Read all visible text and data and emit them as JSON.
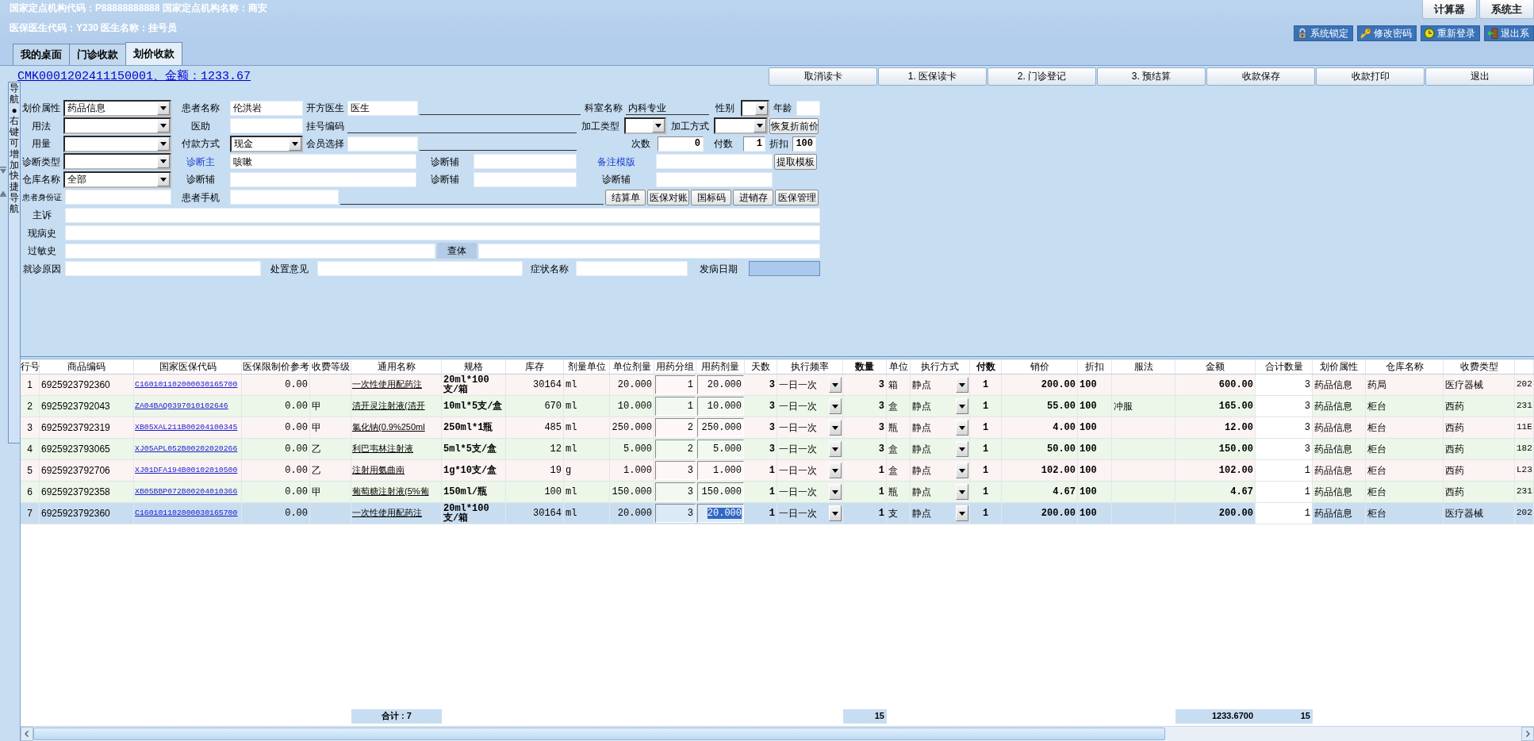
{
  "header": {
    "info_lines": [
      "国家定点机构代码：P88888888888 国家定点机构名称：商安",
      "医保医生代码：Y230 医生名称：挂号员"
    ],
    "top_buttons": [
      "计算器",
      "系统主"
    ],
    "system_buttons": [
      "系统锁定",
      "修改密码",
      "重新登录",
      "退出系"
    ]
  },
  "tabs": [
    {
      "label": "我的桌面",
      "selected": false
    },
    {
      "label": "门诊收款",
      "selected": false
    },
    {
      "label": "划价收款",
      "selected": true
    }
  ],
  "order_link": "CMK0001202411150001、金额：1233.67",
  "action_buttons": [
    "取消读卡",
    "1. 医保读卡",
    "2. 门诊登记",
    "3. 预结算",
    "收款保存",
    "收款打印",
    "退出"
  ],
  "nav_strip": "导航●右键可增加快捷导航",
  "form": {
    "lines": [
      {
        "fields": [
          {
            "kind": "label",
            "text": "划价属性"
          },
          {
            "kind": "select",
            "value": "药品信息"
          },
          {
            "kind": "label",
            "text": "患者名称"
          },
          {
            "kind": "input",
            "value": "伦洪岩"
          },
          {
            "kind": "label",
            "text": "开方医生"
          },
          {
            "kind": "input",
            "value": "医生"
          },
          {
            "kind": "line"
          },
          {
            "kind": "label",
            "text": "科室名称"
          },
          {
            "kind": "line",
            "value": "内科专业"
          },
          {
            "kind": "label",
            "text": "性别"
          },
          {
            "kind": "select"
          },
          {
            "kind": "label",
            "text": "年龄"
          },
          {
            "kind": "input"
          }
        ]
      },
      {
        "fields": [
          {
            "kind": "label",
            "text": "用法"
          },
          {
            "kind": "select"
          },
          {
            "kind": "label",
            "text": "医助"
          },
          {
            "kind": "input"
          },
          {
            "kind": "label",
            "text": "挂号编码"
          },
          {
            "kind": "line"
          },
          {
            "kind": "label",
            "text": "加工类型"
          },
          {
            "kind": "select"
          },
          {
            "kind": "label",
            "text": "加工方式"
          },
          {
            "kind": "select"
          },
          {
            "kind": "button",
            "text": "恢复折前价"
          }
        ]
      },
      {
        "fields": [
          {
            "kind": "label",
            "text": "用量"
          },
          {
            "kind": "select"
          },
          {
            "kind": "label",
            "text": "付款方式"
          },
          {
            "kind": "select",
            "value": "现金"
          },
          {
            "kind": "label",
            "text": "会员选择"
          },
          {
            "kind": "input"
          },
          {
            "kind": "line"
          },
          {
            "kind": "label",
            "text": "次数"
          },
          {
            "kind": "number",
            "value": "0"
          },
          {
            "kind": "label",
            "text": "付数"
          },
          {
            "kind": "number",
            "value": "1"
          },
          {
            "kind": "label",
            "text": "折扣"
          },
          {
            "kind": "number",
            "value": "100"
          }
        ]
      },
      {
        "fields": [
          {
            "kind": "label",
            "text": "诊断类型"
          },
          {
            "kind": "select"
          },
          {
            "kind": "link",
            "text": "诊断主"
          },
          {
            "kind": "input",
            "value": "咳嗽"
          },
          {
            "kind": "label",
            "text": "诊断辅"
          },
          {
            "kind": "input"
          },
          {
            "kind": "link",
            "text": "备注模版"
          },
          {
            "kind": "input"
          },
          {
            "kind": "button",
            "text": "提取模板"
          }
        ]
      },
      {
        "fields": [
          {
            "kind": "label",
            "text": "仓库名称"
          },
          {
            "kind": "select",
            "value": "全部"
          },
          {
            "kind": "label",
            "text": "诊断辅"
          },
          {
            "kind": "input"
          },
          {
            "kind": "label",
            "text": "诊断辅"
          },
          {
            "kind": "input"
          },
          {
            "kind": "label",
            "text": "诊断辅"
          },
          {
            "kind": "input"
          }
        ]
      },
      {
        "fields": [
          {
            "kind": "label",
            "text": "患者身份证"
          },
          {
            "kind": "input"
          },
          {
            "kind": "label",
            "text": "患者手机"
          },
          {
            "kind": "input"
          },
          {
            "kind": "line"
          },
          {
            "kind": "button",
            "text": "结算单"
          },
          {
            "kind": "button",
            "text": "医保对账"
          },
          {
            "kind": "button",
            "text": "国标码"
          },
          {
            "kind": "button",
            "text": "进销存"
          },
          {
            "kind": "button",
            "text": "医保管理"
          }
        ]
      },
      {
        "fields": [
          {
            "kind": "label",
            "text": "主诉"
          },
          {
            "kind": "input"
          }
        ]
      },
      {
        "fields": [
          {
            "kind": "label",
            "text": "现病史"
          },
          {
            "kind": "input"
          }
        ]
      },
      {
        "fields": [
          {
            "kind": "label",
            "text": "过敏史"
          },
          {
            "kind": "input"
          },
          {
            "kind": "panel",
            "text": "查体"
          },
          {
            "kind": "input"
          }
        ]
      },
      {
        "fields": [
          {
            "kind": "label",
            "text": "就诊原因"
          },
          {
            "kind": "input"
          },
          {
            "kind": "label",
            "text": "处置意见"
          },
          {
            "kind": "input"
          },
          {
            "kind": "label",
            "text": "症状名称"
          },
          {
            "kind": "input"
          },
          {
            "kind": "label",
            "text": "发病日期"
          },
          {
            "kind": "date"
          }
        ]
      }
    ]
  },
  "table": {
    "columns": [
      "行号",
      "商品编码",
      "国家医保代码",
      "医保限制价参考",
      "收费等级",
      "通用名称",
      "规格",
      "库存",
      "剂量单位",
      "单位剂量",
      "用药分组",
      "用药剂量",
      "天数",
      "执行频率",
      "数量",
      "单位",
      "执行方式",
      "付数",
      "销价",
      "折扣",
      "服法",
      "金额",
      "合计数量",
      "划价属性",
      "仓库名称",
      "收费类型"
    ],
    "rows": [
      {
        "selected": false,
        "row_no": "1",
        "product_code": "6925923792360",
        "insurance_code": "C160101102000030165700",
        "price_limit": "0.00",
        "generic_name": "一次性使用配药注",
        "spec": "20ml*100支/箱",
        "stock": "30164",
        "dose_unit": "ml",
        "unit_dose": "20.000",
        "group": "1",
        "dose": "20.000",
        "days": "3",
        "frequency": "一日一次",
        "quantity": "3",
        "unit": "箱",
        "method": "静点",
        "doses": "1",
        "price": "200.00",
        "discount": "100",
        "amount": "600.00",
        "total_quantity": "3",
        "pricing_attribute": "药品信息",
        "warehouse": "药局",
        "fee_type": "医疗器械",
        "column_27": "202"
      },
      {
        "selected": false,
        "row_no": "2",
        "product_code": "6925923792043",
        "insurance_code": "ZA04BAQ0397010102646",
        "price_limit": "0.00",
        "fee_grade": "甲",
        "generic_name": "清开灵注射液(清开",
        "spec": "10ml*5支/盒",
        "stock": "670",
        "dose_unit": "ml",
        "unit_dose": "10.000",
        "group": "1",
        "dose": "10.000",
        "days": "3",
        "frequency": "一日一次",
        "quantity": "3",
        "unit": "盒",
        "method": "静点",
        "doses": "1",
        "price": "55.00",
        "discount": "100",
        "usage": "冲服",
        "amount": "165.00",
        "total_quantity": "3",
        "pricing_attribute": "药品信息",
        "warehouse": "柜台",
        "fee_type": "西药",
        "column_27": "231"
      },
      {
        "selected": false,
        "row_no": "3",
        "product_code": "6925923792319",
        "insurance_code": "XB05XAL211B00204100345",
        "price_limit": "0.00",
        "fee_grade": "甲",
        "generic_name": "氯化钠(0.9%250ml",
        "spec": "250ml*1瓶",
        "stock": "485",
        "dose_unit": "ml",
        "unit_dose": "250.000",
        "group": "2",
        "dose": "250.000",
        "days": "3",
        "frequency": "一日一次",
        "quantity": "3",
        "unit": "瓶",
        "method": "静点",
        "doses": "1",
        "price": "4.00",
        "discount": "100",
        "amount": "12.00",
        "total_quantity": "3",
        "pricing_attribute": "药品信息",
        "warehouse": "柜台",
        "fee_type": "西药",
        "column_27": "11E"
      },
      {
        "selected": false,
        "row_no": "4",
        "product_code": "6925923793065",
        "insurance_code": "XJ05APL052B00202020266",
        "price_limit": "0.00",
        "fee_grade": "乙",
        "generic_name": "利巴韦林注射液",
        "spec": "5ml*5支/盒",
        "stock": "12",
        "dose_unit": "ml",
        "unit_dose": "5.000",
        "group": "2",
        "dose": "5.000",
        "days": "3",
        "frequency": "一日一次",
        "quantity": "3",
        "unit": "盒",
        "method": "静点",
        "doses": "1",
        "price": "50.00",
        "discount": "100",
        "amount": "150.00",
        "total_quantity": "3",
        "pricing_attribute": "药品信息",
        "warehouse": "柜台",
        "fee_type": "西药",
        "column_27": "182"
      },
      {
        "selected": false,
        "row_no": "5",
        "product_code": "6925923792706",
        "insurance_code": "XJ01DFA194B00102010500",
        "price_limit": "0.00",
        "fee_grade": "乙",
        "generic_name": "注射用氨曲南",
        "spec": "1g*10支/盒",
        "stock": "19",
        "dose_unit": "g",
        "unit_dose": "1.000",
        "group": "3",
        "dose": "1.000",
        "days": "1",
        "frequency": "一日一次",
        "quantity": "1",
        "unit": "盒",
        "method": "静点",
        "doses": "1",
        "price": "102.00",
        "discount": "100",
        "amount": "102.00",
        "total_quantity": "1",
        "pricing_attribute": "药品信息",
        "warehouse": "柜台",
        "fee_type": "西药",
        "column_27": "L23"
      },
      {
        "selected": false,
        "row_no": "6",
        "product_code": "6925923792358",
        "insurance_code": "XB05BBP072B00204010366",
        "price_limit": "0.00",
        "fee_grade": "甲",
        "generic_name": "葡萄糖注射液(5%葡",
        "spec": "150ml/瓶",
        "stock": "100",
        "dose_unit": "ml",
        "unit_dose": "150.000",
        "group": "3",
        "dose": "150.000",
        "days": "1",
        "frequency": "一日一次",
        "quantity": "1",
        "unit": "瓶",
        "method": "静点",
        "doses": "1",
        "price": "4.67",
        "discount": "100",
        "amount": "4.67",
        "total_quantity": "1",
        "pricing_attribute": "药品信息",
        "warehouse": "柜台",
        "fee_type": "西药",
        "column_27": "231"
      },
      {
        "selected": true,
        "row_no": "7",
        "product_code": "6925923792360",
        "insurance_code": "C160101102000030165700",
        "price_limit": "0.00",
        "generic_name": "一次性使用配药注",
        "spec": "20ml*100支/箱",
        "stock": "30164",
        "dose_unit": "ml",
        "unit_dose": "20.000",
        "group": "3",
        "dose": "20.000",
        "days": "1",
        "frequency": "一日一次",
        "quantity": "1",
        "unit": "支",
        "method": "静点",
        "doses": "1",
        "price": "200.00",
        "discount": "100",
        "amount": "200.00",
        "total_quantity": "1",
        "pricing_attribute": "药品信息",
        "warehouse": "柜台",
        "fee_type": "医疗器械",
        "column_27": "202"
      }
    ],
    "totals": {
      "generic_name": "合计 : 7",
      "quantity": "15",
      "amount": "1233.6700",
      "total_quantity": "15"
    }
  }
}
